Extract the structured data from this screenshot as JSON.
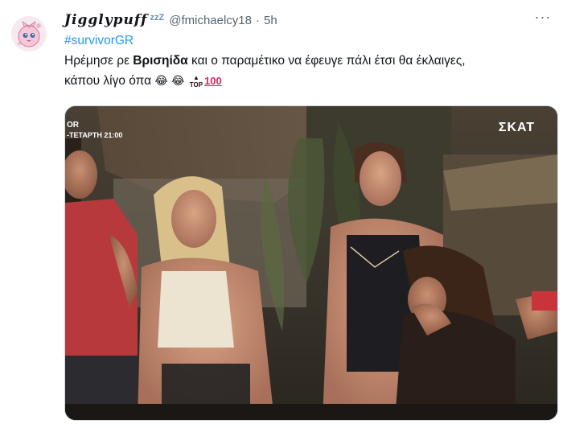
{
  "tweet": {
    "display_name": "Jigglypuff",
    "sleep_emoji": "zzZ",
    "handle": "@fmichaelcy18",
    "separator": "·",
    "time": "5h",
    "more_glyph": "···",
    "hashtag": "#survivorGR",
    "text_line1_pre": "Ηρέμησε ρε ",
    "text_line1_bold": "Βρισηίδα",
    "text_line1_post": " και ο παραμέτικο να έφευγε πάλι έτσι θα έκλαιγες,",
    "text_line2": "κάπου λίγο όπα ",
    "emoji_laugh_1": "😂",
    "emoji_laugh_2": "😂",
    "emoji_top": "TOP",
    "emoji_100": "100"
  },
  "media": {
    "channel_logo": "ΣΚΑΤ",
    "program_line1": "OR",
    "program_line2": "-ΤΕΤΑΡΤΗ 21:00"
  },
  "colors": {
    "link": "#1d9bf0",
    "secondary_text": "#536471",
    "border": "#cfd9de"
  },
  "icons": [
    "more-icon",
    "avatar-jigglypuff-icon",
    "laugh-emoji-icon",
    "top-emoji-icon",
    "hundred-emoji-icon"
  ]
}
